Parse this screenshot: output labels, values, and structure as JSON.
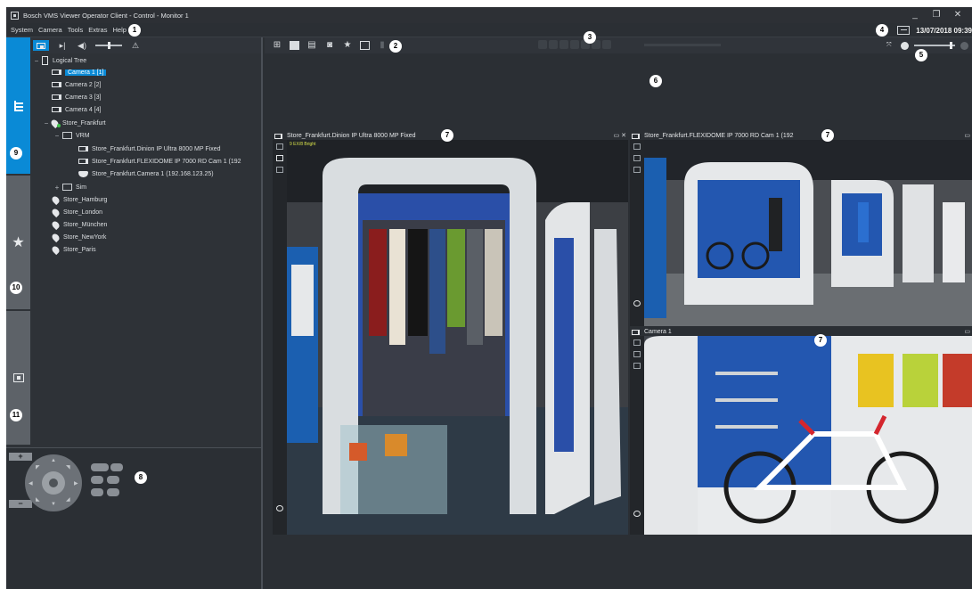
{
  "window": {
    "title": "Bosch VMS Viewer Operator Client - Control - Monitor 1",
    "minimize": "_",
    "restore": "❐",
    "close": "✕"
  },
  "menu": {
    "items": [
      "System",
      "Camera",
      "Tools",
      "Extras",
      "Help"
    ],
    "datetime": "13/07/2018 09:39"
  },
  "left_toolbar": {
    "icons": [
      "live-camera-icon",
      "instant-playback-icon",
      "speaker-icon",
      "volume-slider",
      "alarm-icon"
    ]
  },
  "tree": {
    "root": "Logical Tree",
    "nodes": [
      {
        "label": "Camera 1 [1]",
        "type": "camera",
        "selected": true
      },
      {
        "label": "Camera 2 [2]",
        "type": "camera"
      },
      {
        "label": "Camera 3 [3]",
        "type": "camera"
      },
      {
        "label": "Camera 4 [4]",
        "type": "camera"
      },
      {
        "label": "Store_Frankfurt",
        "type": "site"
      },
      {
        "label": "VRM",
        "type": "folder"
      },
      {
        "label": "Store_Frankfurt.Dinion IP Ultra 8000 MP Fixed",
        "type": "camera"
      },
      {
        "label": "Store_Frankfurt.FLEXIDOME IP 7000 RD Cam 1 (192",
        "type": "camera"
      },
      {
        "label": "Store_Frankfurt.Camera 1 (192.168.123.25)",
        "type": "dome"
      },
      {
        "label": "Sim",
        "type": "folder"
      },
      {
        "label": "Store_Hamburg",
        "type": "site"
      },
      {
        "label": "Store_London",
        "type": "site"
      },
      {
        "label": "Store_München",
        "type": "site"
      },
      {
        "label": "Store_NewYork",
        "type": "site"
      },
      {
        "label": "Store_Paris",
        "type": "site"
      }
    ]
  },
  "ptz": {
    "zoom_in": "+",
    "zoom_out": "−"
  },
  "panes": [
    {
      "title": "Store_Frankfurt.Dinion IP Ultra 8000 MP Fixed",
      "overlay": "9 EX/8 Bright",
      "controls": "▭ ✕"
    },
    {
      "title": "Store_Frankfurt.FLEXIDOME IP 7000 RD Cam 1 (192",
      "controls": "▭"
    },
    {
      "title": "Camera 1",
      "controls": "▭"
    }
  ],
  "callouts": [
    "1",
    "2",
    "3",
    "4",
    "5",
    "6",
    "7",
    "7",
    "7",
    "8",
    "9",
    "10",
    "11"
  ],
  "colors": {
    "accent": "#0a8ad6",
    "background": "#2b2f34",
    "panel": "#2e3237",
    "tab_inactive": "#5d6268"
  }
}
